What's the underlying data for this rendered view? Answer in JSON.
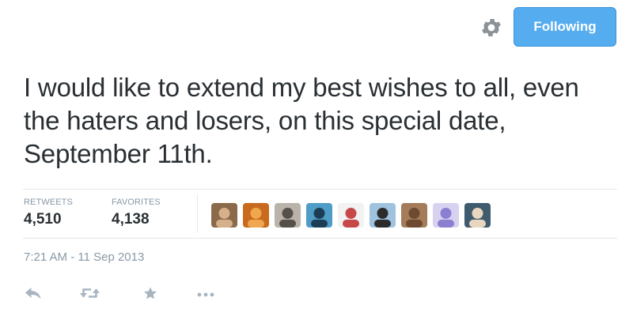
{
  "header": {
    "follow_button_label": "Following",
    "settings_icon": "gear-icon"
  },
  "tweet": {
    "text": "I would like to extend my best wishes to all, even the haters and losers, on this special date, September 11th.",
    "timestamp": "7:21 AM - 11 Sep 2013"
  },
  "stats": {
    "retweets_label": "RETWEETS",
    "retweets_value": "4,510",
    "favorites_label": "FAVORITES",
    "favorites_value": "4,138"
  },
  "favoriter_avatars": [
    {
      "bg": "#8a6a4a",
      "fg": "#d6b08a"
    },
    {
      "bg": "#c96a1e",
      "fg": "#f0a850"
    },
    {
      "bg": "#b9b3aa",
      "fg": "#55504a"
    },
    {
      "bg": "#4f9cc7",
      "fg": "#1d3d55"
    },
    {
      "bg": "#f2f2f2",
      "fg": "#c74848"
    },
    {
      "bg": "#9fc3df",
      "fg": "#2b2b2b"
    },
    {
      "bg": "#a47c5a",
      "fg": "#6e4a30"
    },
    {
      "bg": "#d8d2f0",
      "fg": "#8a7fd0"
    },
    {
      "bg": "#3f5b6e",
      "fg": "#e9d6c0"
    }
  ],
  "actions": {
    "reply_icon": "reply-icon",
    "retweet_icon": "retweet-icon",
    "favorite_icon": "star-icon",
    "more_icon": "more-dots-icon"
  },
  "colors": {
    "accent": "#55acee",
    "muted_text": "#8899a6",
    "text": "#292f33",
    "icon": "#a8b5c1"
  }
}
